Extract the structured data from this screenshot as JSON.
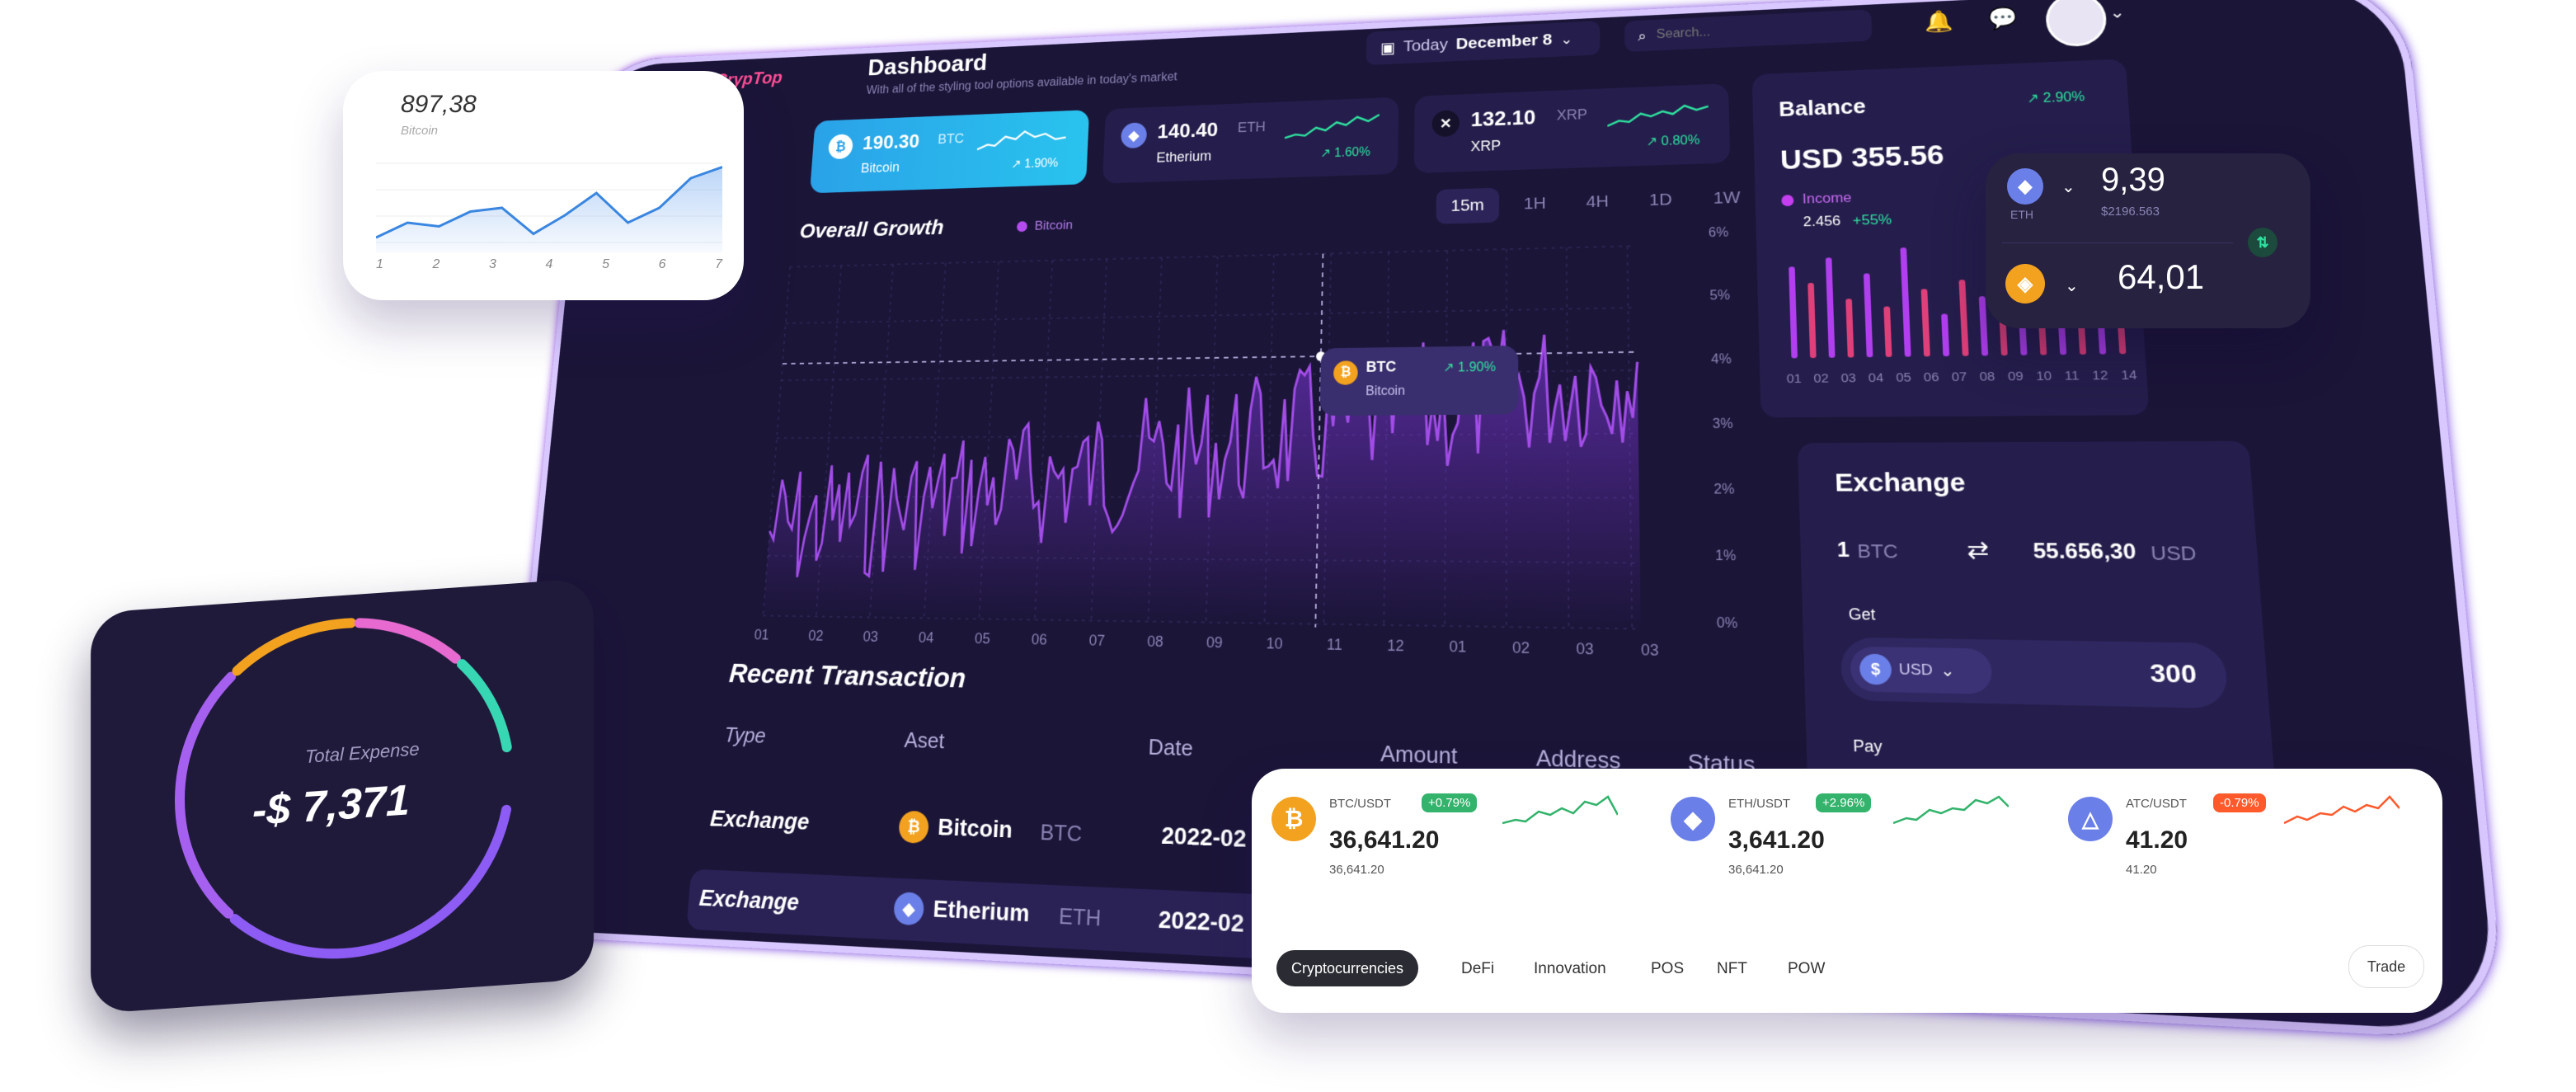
{
  "app": {
    "logo": "CrypTop",
    "title": "Dashboard",
    "subtitle": "With all of the styling tool options available in today's market"
  },
  "header": {
    "date_prefix": "Today",
    "date": "December 8",
    "search_placeholder": "Search..."
  },
  "tickers": [
    {
      "value": "190.30",
      "symbol": "BTC",
      "name": "Bitcoin",
      "change": "1.90%"
    },
    {
      "value": "140.40",
      "symbol": "ETH",
      "name": "Etherium",
      "change": "1.60%"
    },
    {
      "value": "132.10",
      "symbol": "XRP",
      "name": "XRP",
      "change": "0.80%"
    }
  ],
  "growth": {
    "title": "Overall Growth",
    "legend": "Bitcoin",
    "ranges": [
      "15m",
      "1H",
      "4H",
      "1D",
      "1W"
    ],
    "active_range": "15m",
    "y_ticks": [
      "6%",
      "5%",
      "4%",
      "3%",
      "2%",
      "1%",
      "0%"
    ],
    "x_ticks": [
      "01",
      "02",
      "03",
      "04",
      "05",
      "06",
      "07",
      "08",
      "09",
      "10",
      "11",
      "12",
      "01",
      "02",
      "03",
      "03"
    ],
    "tooltip": {
      "symbol": "BTC",
      "name": "Bitcoin",
      "change": "1.90%"
    }
  },
  "balance": {
    "title": "Balance",
    "change": "2.90%",
    "amount": "USD 355.56",
    "income_label": "Income",
    "income_value": "2.456",
    "income_change": "+55%",
    "x_ticks": [
      "01",
      "02",
      "03",
      "04",
      "05",
      "06",
      "07",
      "08",
      "09",
      "10",
      "11",
      "12",
      "14"
    ]
  },
  "exchange": {
    "title": "Exchange",
    "from_amount": "1",
    "from_unit": "BTC",
    "to_amount": "55.656,30",
    "to_unit": "USD",
    "get_label": "Get",
    "get_currency": "USD",
    "get_amount": "300",
    "pay_label": "Pay"
  },
  "transactions": {
    "title": "Recent Transaction",
    "headers": [
      "Type",
      "Aset",
      "Date",
      "Amount",
      "Address",
      "Status"
    ],
    "rows": [
      {
        "type": "Exchange",
        "asset": "Bitcoin",
        "symbol": "BTC",
        "date": "2022-02"
      },
      {
        "type": "Exchange",
        "asset": "Etherium",
        "symbol": "ETH",
        "date": "2022-02"
      }
    ]
  },
  "mini_chart": {
    "value": "897,38",
    "label": "Bitcoin",
    "x_ticks": [
      "1",
      "2",
      "3",
      "4",
      "5",
      "6",
      "7"
    ],
    "values": [
      3.0,
      3.4,
      3.3,
      3.7,
      3.8,
      3.1,
      3.6,
      4.2,
      3.4,
      3.8,
      4.6,
      4.9
    ]
  },
  "expense": {
    "label": "Total Expense",
    "amount": "-$ 7,371"
  },
  "wallet": {
    "eth_value": "9,39",
    "eth_label": "ETH",
    "eth_sub": "$2196.563",
    "bnb_value": "64,01"
  },
  "markets": {
    "pairs": [
      {
        "pair": "BTC/USDT",
        "badge": "+0.79%",
        "price": "36,641.20",
        "sub": "36,641.20",
        "badge_color": "#33b36b"
      },
      {
        "pair": "ETH/USDT",
        "badge": "+2.96%",
        "price": "3,641.20",
        "sub": "36,641.20",
        "badge_color": "#33b36b"
      },
      {
        "pair": "ATC/USDT",
        "badge": "-0.79%",
        "price": "41.20",
        "sub": "41.20",
        "badge_color": "#ff5a2c"
      }
    ],
    "tabs": [
      "Cryptocurrencies",
      "DeFi",
      "Innovation",
      "POS",
      "NFT",
      "POW"
    ],
    "active_tab": "Cryptocurrencies",
    "trade_label": "Trade"
  },
  "colors": {
    "accent": "#8a3cf0",
    "bg": "#1b1538",
    "card": "#251e4c",
    "green": "#2ee3a0",
    "btc": "#f3a21f",
    "eth": "#6b7fe8"
  }
}
